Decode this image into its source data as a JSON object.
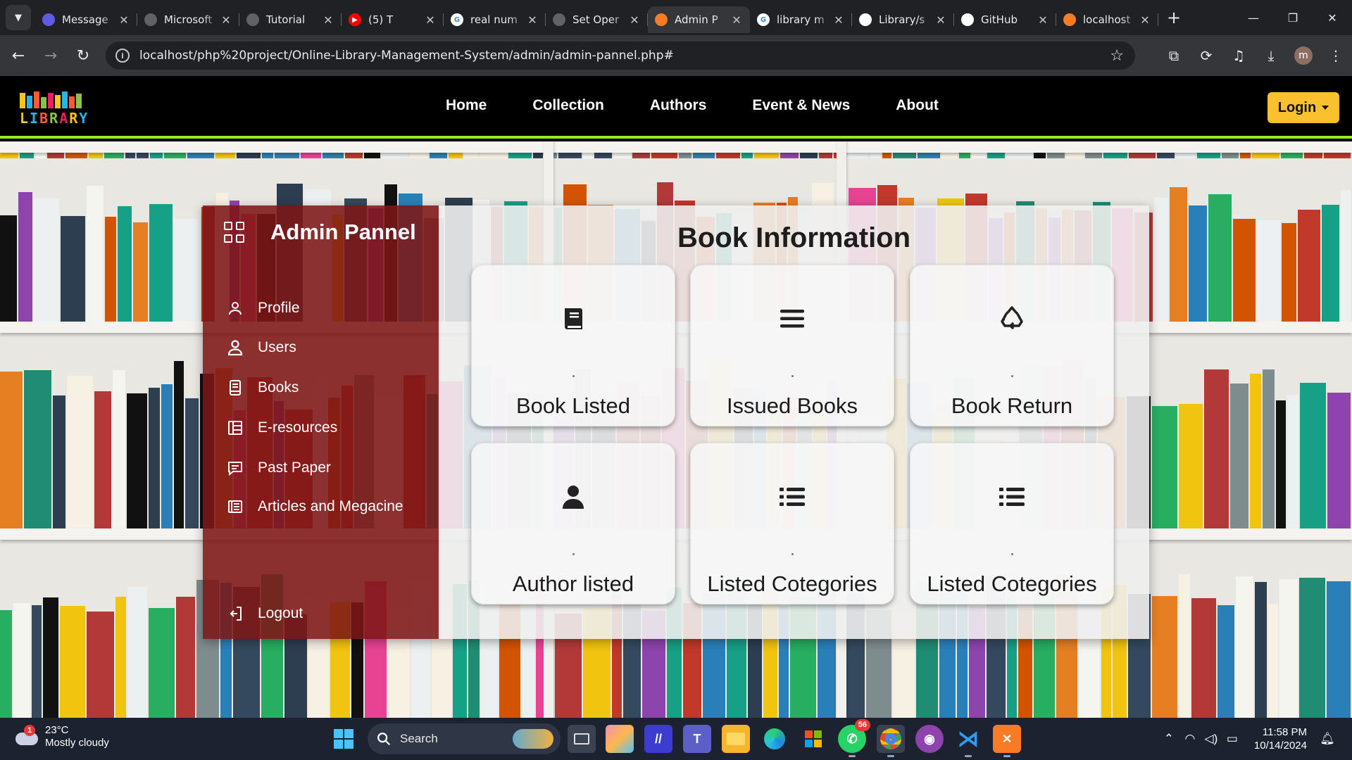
{
  "browser": {
    "tabs": [
      {
        "title": "Message",
        "favicon_color": "#5e5ce6",
        "favicon_glyph": "",
        "active": false
      },
      {
        "title": "Microsoft",
        "favicon_color": "#5f6368",
        "favicon_glyph": "",
        "active": false
      },
      {
        "title": "Tutorial",
        "favicon_color": "#5f6368",
        "favicon_glyph": "",
        "active": false
      },
      {
        "title": "(5) T",
        "favicon_color": "#ff0000",
        "favicon_glyph": "▶",
        "active": false
      },
      {
        "title": "real num",
        "favicon_color": "#ffffff",
        "favicon_glyph": "G",
        "active": false
      },
      {
        "title": "Set Oper",
        "favicon_color": "#5f6368",
        "favicon_glyph": "",
        "active": false
      },
      {
        "title": "Admin P",
        "favicon_color": "#fb7a24",
        "favicon_glyph": "",
        "active": true
      },
      {
        "title": "library m",
        "favicon_color": "#ffffff",
        "favicon_glyph": "G",
        "active": false
      },
      {
        "title": "Library/s",
        "favicon_color": "#ffffff",
        "favicon_glyph": "",
        "active": false
      },
      {
        "title": "GitHub",
        "favicon_color": "#ffffff",
        "favicon_glyph": "",
        "active": false
      },
      {
        "title": "localhost",
        "favicon_color": "#fb7a24",
        "favicon_glyph": "",
        "active": false
      }
    ],
    "url": "localhost/php%20project/Online-Library-Management-System/admin/admin-pannel.php#",
    "profile_initial": "m"
  },
  "site": {
    "logo_text": "LIBRARY",
    "nav": [
      "Home",
      "Collection",
      "Authors",
      "Event & News",
      "About"
    ],
    "login_label": "Login",
    "accent_color": "#9aea1f",
    "login_color": "#fbc02d"
  },
  "admin": {
    "title": "Admin Pannel",
    "menu": [
      {
        "label": "Profile",
        "icon": "user-icon"
      },
      {
        "label": "Users",
        "icon": "users-icon"
      },
      {
        "label": "Books",
        "icon": "book-icon"
      },
      {
        "label": "E-resources",
        "icon": "layout-icon"
      },
      {
        "label": "Past Paper",
        "icon": "message-icon"
      },
      {
        "label": "Articles and Megacine",
        "icon": "newspaper-icon"
      }
    ],
    "logout_label": "Logout",
    "sidebar_color": "#7d1616"
  },
  "content": {
    "title": "Book Information",
    "cards": [
      {
        "label": "Book Listed",
        "icon": "book-icon"
      },
      {
        "label": "Issued Books",
        "icon": "bars-icon"
      },
      {
        "label": "Book Return",
        "icon": "recycle-icon"
      },
      {
        "label": "Author listed",
        "icon": "user-icon"
      },
      {
        "label": "Listed Cotegories",
        "icon": "list-icon"
      },
      {
        "label": "Listed Cotegories",
        "icon": "list-icon"
      }
    ]
  },
  "taskbar": {
    "weather_temp": "23°C",
    "weather_desc": "Mostly cloudy",
    "weather_badge": "1",
    "search_placeholder": "Search",
    "whatsapp_badge": "56",
    "time": "11:58 PM",
    "date": "10/14/2024"
  }
}
